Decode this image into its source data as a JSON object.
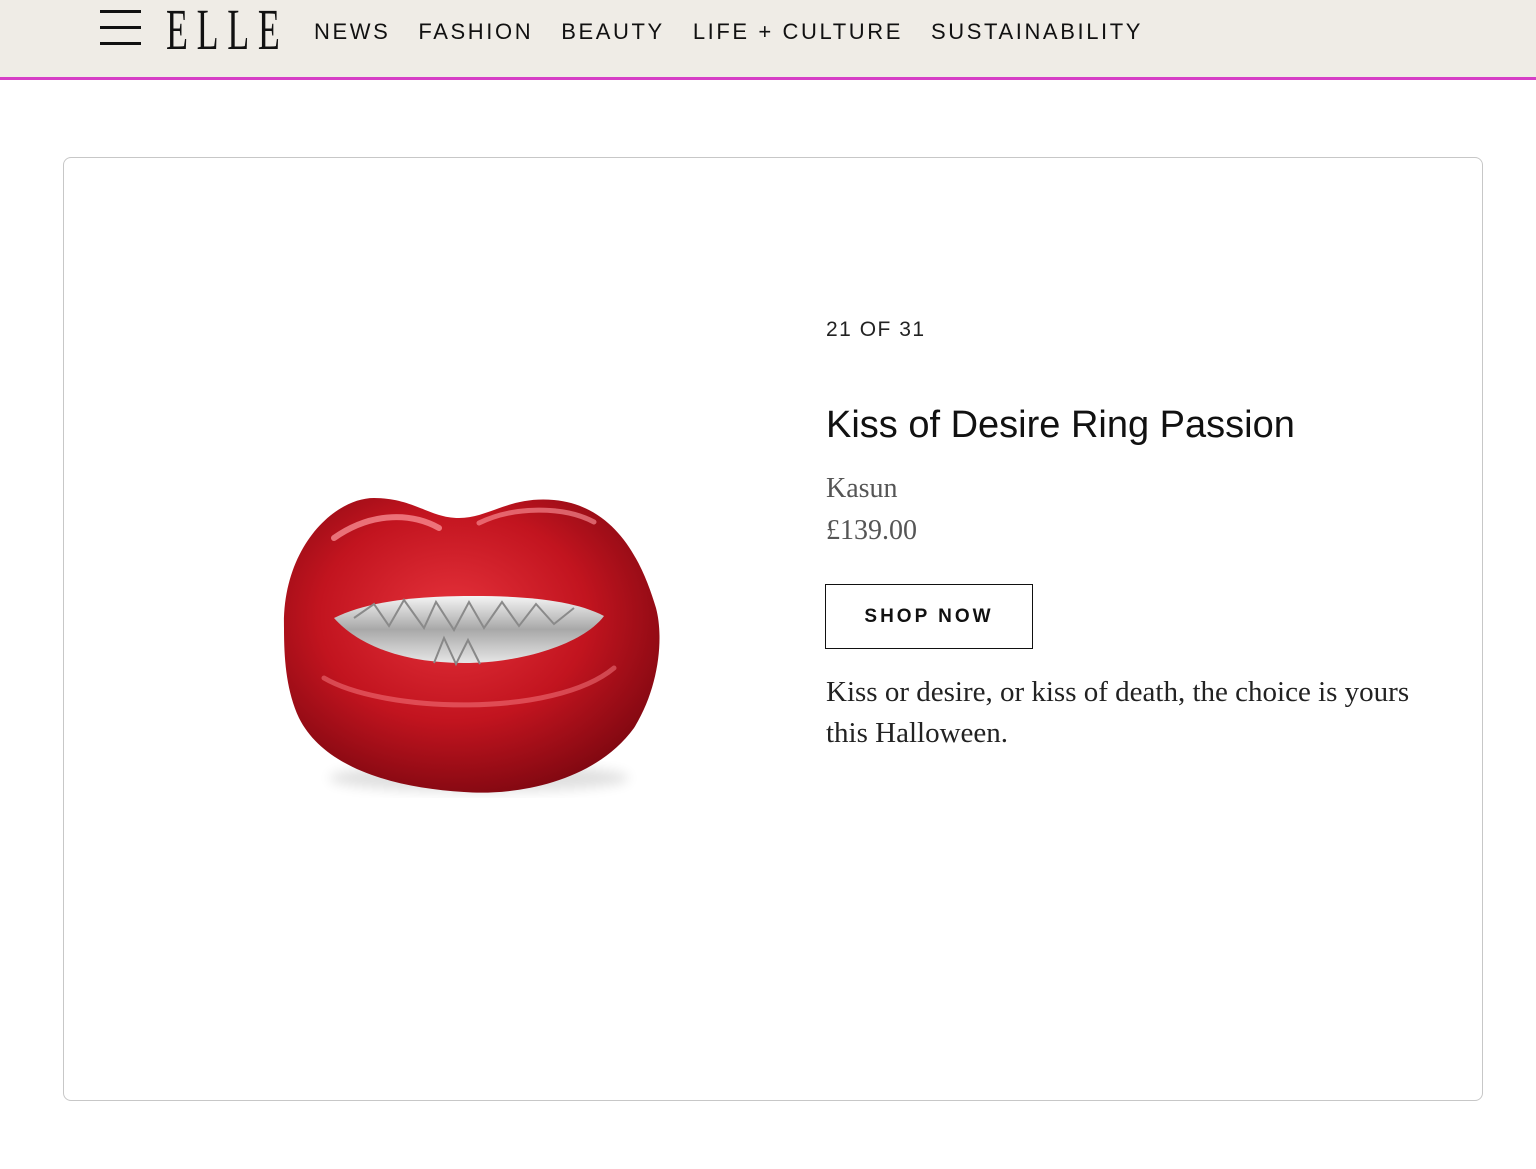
{
  "header": {
    "logo": "ELLE",
    "nav": [
      "NEWS",
      "FASHION",
      "BEAUTY",
      "LIFE + CULTURE",
      "SUSTAINABILITY"
    ],
    "accent_color": "#d63ec6",
    "background_color": "#efece6"
  },
  "slide": {
    "counter": "21 OF 31",
    "title": "Kiss of Desire Ring Passion",
    "brand": "Kasun",
    "price": "£139.00",
    "button_label": "SHOP NOW",
    "description": "Kiss or desire, or kiss of death, the choice is yours this Halloween.",
    "image_icon": "red-lips-ring"
  }
}
